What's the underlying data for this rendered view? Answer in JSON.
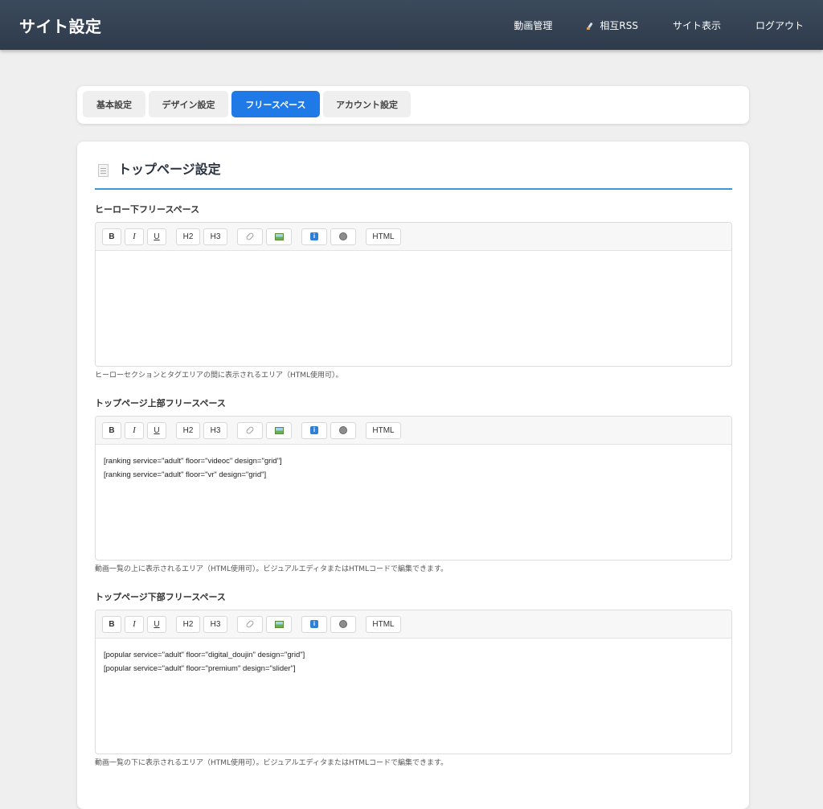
{
  "header": {
    "title": "サイト設定",
    "nav": [
      "動画管理",
      "相互RSS",
      "サイト表示",
      "ログアウト"
    ]
  },
  "tabs": [
    {
      "label": "基本設定",
      "active": false
    },
    {
      "label": "デザイン設定",
      "active": false
    },
    {
      "label": "フリースペース",
      "active": true
    },
    {
      "label": "アカウント設定",
      "active": false
    }
  ],
  "colors": {
    "accent": "#1f7ae8",
    "header_bg": "#2e3b4b",
    "divider": "#3a98d4"
  },
  "card": {
    "title": "トップページ設定",
    "icon": "document-icon"
  },
  "toolbar": {
    "bold": "B",
    "italic": "I",
    "underline": "U",
    "h2": "H2",
    "h3": "H3",
    "html": "HTML"
  },
  "sections": [
    {
      "label": "ヒーロー下フリースペース",
      "lines": [
        "",
        ""
      ],
      "help": "ヒーローセクションとタグエリアの間に表示されるエリア（HTML使用可）。"
    },
    {
      "label": "トップページ上部フリースペース",
      "lines": [
        "[ranking service=\"adult\" floor=\"videoc\" design=\"grid\"]",
        "[ranking service=\"adult\" floor=\"vr\" design=\"grid\"]"
      ],
      "help": "動画一覧の上に表示されるエリア（HTML使用可）。ビジュアルエディタまたはHTMLコードで編集できます。"
    },
    {
      "label": "トップページ下部フリースペース",
      "lines": [
        "[popular service=\"adult\" floor=\"digital_doujin\" design=\"grid\"]",
        "[popular service=\"adult\" floor=\"premium\" design=\"slider\"]"
      ],
      "help": "動画一覧の下に表示されるエリア（HTML使用可）。ビジュアルエディタまたはHTMLコードで編集できます。"
    }
  ]
}
